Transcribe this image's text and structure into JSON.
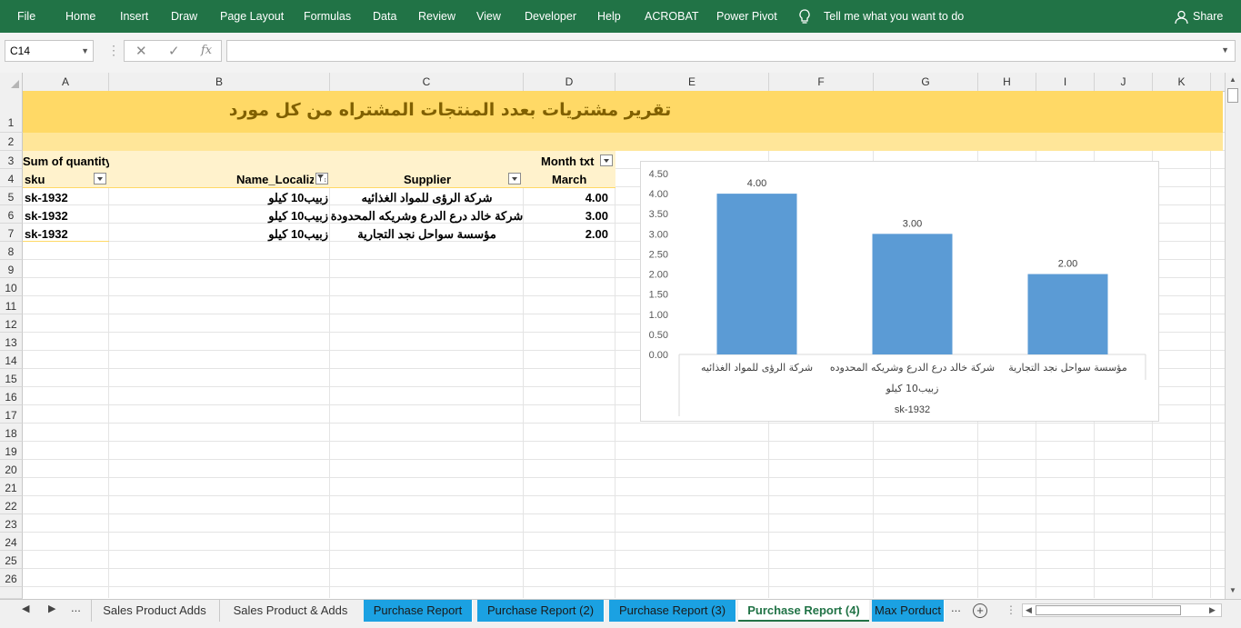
{
  "ribbon": {
    "menu": [
      "File",
      "Home",
      "Insert",
      "Draw",
      "Page Layout",
      "Formulas",
      "Data",
      "Review",
      "View",
      "Developer",
      "Help",
      "ACROBAT",
      "Power Pivot"
    ],
    "tell_me": "Tell me what you want to do",
    "share": "Share"
  },
  "formula_bar": {
    "name_box": "C14",
    "cancel_glyph": "✕",
    "enter_glyph": "✓",
    "fx_label": "fx",
    "formula": ""
  },
  "columns": [
    "A",
    "B",
    "C",
    "D",
    "E",
    "F",
    "G",
    "H",
    "I",
    "J",
    "K"
  ],
  "rows": [
    "1",
    "2",
    "3",
    "4",
    "5",
    "6",
    "7",
    "8",
    "9",
    "10",
    "11",
    "12",
    "13",
    "14",
    "15",
    "16",
    "17",
    "18",
    "19",
    "20",
    "21",
    "22",
    "23",
    "24",
    "25",
    "26"
  ],
  "sheet": {
    "title": "تقرير مشتريات بعدد المنتجات المشتراه من كل مورد",
    "pivot": {
      "values_label": "Sum of quantity",
      "column_field": "Month txt",
      "headers": {
        "sku": "sku",
        "name": "Name_Localiz",
        "supplier": "Supplier",
        "month": "March"
      },
      "rows": [
        {
          "sku": "sk-1932",
          "name": "زبيب10 كيلو",
          "supplier": "شركة الرؤى للمواد الغذائيه",
          "value": "4.00"
        },
        {
          "sku": "sk-1932",
          "name": "زبيب10 كيلو",
          "supplier": "شركة خالد درع الدرع وشريكه المحدودة",
          "value": "3.00"
        },
        {
          "sku": "sk-1932",
          "name": "زبيب10 كيلو",
          "supplier": "مؤسسة سواحل نجد التجارية",
          "value": "2.00"
        }
      ]
    }
  },
  "chart_data": {
    "type": "bar",
    "categories": [
      "شركة الرؤى للمواد الغذائيه",
      "شركة خالد درع الدرع وشريكه المحدوده",
      "مؤسسة سواحل نجد التجارية"
    ],
    "values": [
      4.0,
      3.0,
      2.0
    ],
    "value_labels": [
      "4.00",
      "3.00",
      "2.00"
    ],
    "group_label_1": "زبيب10 كيلو",
    "group_label_2": "sk-1932",
    "yticks": [
      "0.00",
      "0.50",
      "1.00",
      "1.50",
      "2.00",
      "2.50",
      "3.00",
      "3.50",
      "4.00",
      "4.50"
    ],
    "ylim": [
      0,
      4.5
    ],
    "grid": false,
    "bar_color": "#5b9bd5"
  },
  "tabs": {
    "ellipsis": "...",
    "items": [
      {
        "label": "Sales Product Adds",
        "style": "plain"
      },
      {
        "label": "Sales Product & Adds",
        "style": "plain"
      },
      {
        "label": "Purchase Report",
        "style": "blue"
      },
      {
        "label": "Purchase Report (2)",
        "style": "blue"
      },
      {
        "label": "Purchase Report (3)",
        "style": "blue"
      },
      {
        "label": "Purchase Report (4)",
        "style": "active"
      },
      {
        "label": "Max Porduct",
        "style": "blue"
      }
    ],
    "more": "..."
  },
  "colors": {
    "excel_green": "#217346",
    "title_band": "#ffd966",
    "band_light": "#ffe699",
    "pivot_header": "#fff2cc",
    "tab_blue": "#1ba1e2"
  }
}
